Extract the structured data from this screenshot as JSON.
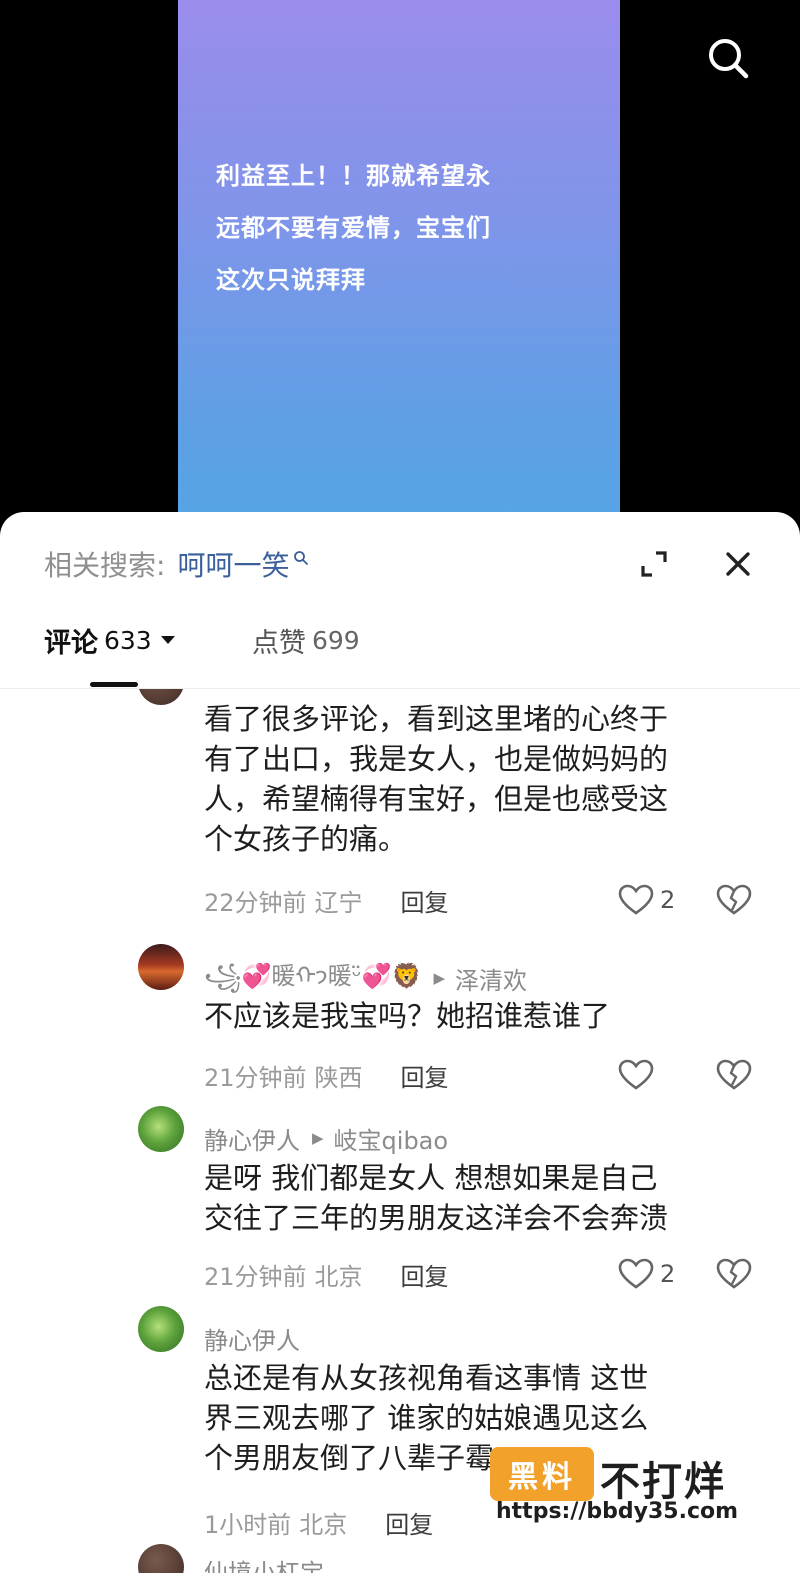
{
  "video": {
    "caption_lines": [
      "利益至上！！那就希望永",
      "远都不要有爱情，宝宝们",
      "这次只说拜拜"
    ]
  },
  "related_search": {
    "label": "相关搜索:",
    "term": "呵呵一笑"
  },
  "tabs": [
    {
      "label": "评论",
      "count": "633",
      "active": true
    },
    {
      "label": "点赞",
      "count": "699",
      "active": false
    }
  ],
  "comments": [
    {
      "lines": [
        "看了很多评论，看到这里堵的心终于",
        "有了出口，我是女人，也是做妈妈的",
        "人，希望楠得有宝好，但是也感受这",
        "个女孩子的痛。"
      ],
      "time": "22分钟前",
      "location": "辽宁",
      "reply": "回复",
      "likes": "2"
    },
    {
      "user": "꧁💞暖ᡣ𐭩暖ᵕ̈💞🦁",
      "reply_to": "泽清欢",
      "lines": [
        "不应该是我宝吗？她招谁惹谁了"
      ],
      "time": "21分钟前",
      "location": "陕西",
      "reply": "回复",
      "likes": ""
    },
    {
      "user": "静心伊人",
      "reply_to": "岐宝qibao",
      "lines": [
        "是呀 我们都是女人 想想如果是自己",
        "交往了三年的男朋友这洋会不会奔溃"
      ],
      "time": "21分钟前",
      "location": "北京",
      "reply": "回复",
      "likes": "2"
    },
    {
      "user": "静心伊人",
      "lines": [
        "总还是有从女孩视角看这事情 这世",
        "界三观去哪了 谁家的姑娘遇见这么",
        "个男朋友倒了八辈子霉"
      ],
      "time": "1小时前",
      "location": "北京",
      "reply": "回复",
      "likes": ""
    },
    {
      "user": "仙境小杠宝"
    }
  ],
  "watermark": {
    "badge": "黑料",
    "title": "不打烊",
    "url": "https://bbdy35.com"
  },
  "colors": {
    "link": "#3a5f9a",
    "video_top": "#9a8cec",
    "video_bottom": "#53a6e6",
    "watermark": "#f2a12a"
  }
}
